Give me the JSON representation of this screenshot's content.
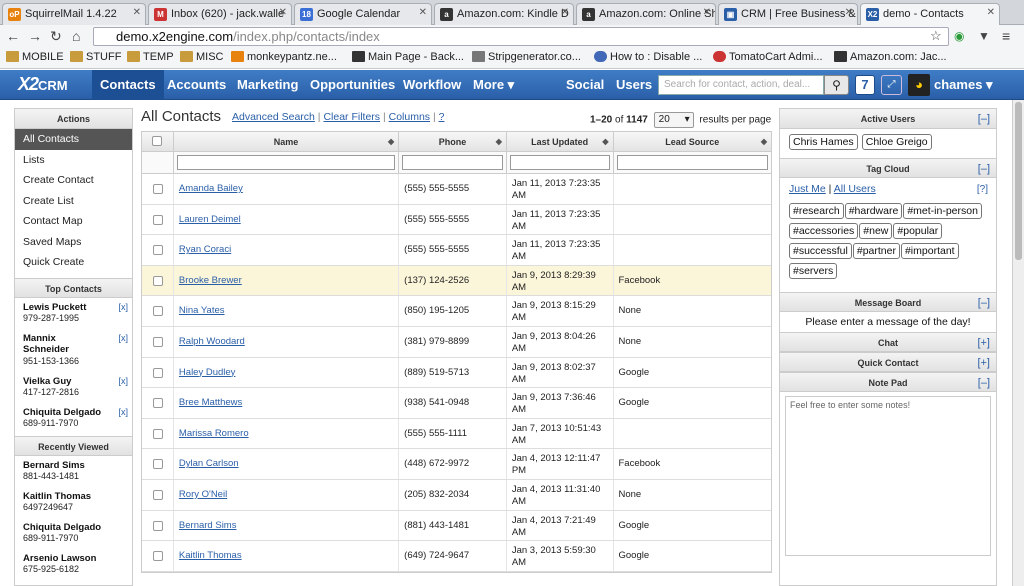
{
  "browser": {
    "tabs": [
      {
        "label": "SquirrelMail 1.4.22",
        "icon_text": "oP",
        "color": "#e8820f"
      },
      {
        "label": "Inbox (620) - jack.walle",
        "icon_text": "M",
        "color": "#c33"
      },
      {
        "label": "Google Calendar",
        "icon_text": "18",
        "color": "#3a70d6"
      },
      {
        "label": "Amazon.com: Kindle D",
        "icon_text": "a",
        "color": "#333"
      },
      {
        "label": "Amazon.com: Online Sh",
        "icon_text": "a",
        "color": "#333"
      },
      {
        "label": "CRM | Free Business &",
        "icon_text": "▣",
        "color": "#2a5fa8"
      },
      {
        "label": "demo - Contacts",
        "icon_text": "X2",
        "color": "#2a5fa8"
      }
    ],
    "window_controls": "– □ ✕",
    "url_host": "demo.x2engine.com",
    "url_path": "/index.php/contacts/index",
    "bookmarks": [
      {
        "label": "MOBILE",
        "color": "#c89b3c"
      },
      {
        "label": "STUFF",
        "color": "#c89b3c"
      },
      {
        "label": "TEMP",
        "color": "#c89b3c"
      },
      {
        "label": "MISC",
        "color": "#c89b3c"
      },
      {
        "label": "monkeypantz.ne...",
        "color": "#e8820f"
      },
      {
        "label": "Main Page - Back...",
        "color": "#333"
      },
      {
        "label": "Stripgenerator.co...",
        "color": "#777"
      },
      {
        "label": "How to : Disable ...",
        "color": "#4169b8"
      },
      {
        "label": "TomatoCart Admi...",
        "color": "#c33"
      },
      {
        "label": "Amazon.com: Jac...",
        "color": "#333"
      }
    ]
  },
  "app": {
    "logo": "X2",
    "logo_suffix": "CRM",
    "nav": [
      "Contacts",
      "Accounts",
      "Marketing",
      "Opportunities",
      "Workflow",
      "More ▾"
    ],
    "nav_right": [
      "Social",
      "Users"
    ],
    "search_placeholder": "Search for contact, action, deal...",
    "notification_count": "7",
    "username": "chames ▾",
    "accent": "#2a5fa8"
  },
  "sidebar": {
    "actions_title": "Actions",
    "actions": [
      "All Contacts",
      "Lists",
      "Create Contact",
      "Create List",
      "Contact Map",
      "Saved Maps",
      "Quick Create"
    ],
    "top_title": "Top Contacts",
    "top_contacts": [
      {
        "name": "Lewis Puckett",
        "phone": "979-287-1995"
      },
      {
        "name": "Mannix Schneider",
        "phone": "951-153-1366"
      },
      {
        "name": "Vielka Guy",
        "phone": "417-127-2816"
      },
      {
        "name": "Chiquita Delgado",
        "phone": "689-911-7970"
      }
    ],
    "remove_label": "[x]",
    "recent_title": "Recently Viewed",
    "recent": [
      {
        "name": "Bernard Sims",
        "phone": "881-443-1481"
      },
      {
        "name": "Kaitlin Thomas",
        "phone": "6497249647"
      },
      {
        "name": "Chiquita Delgado",
        "phone": "689-911-7970"
      },
      {
        "name": "Arsenio Lawson",
        "phone": "675-925-6182"
      }
    ]
  },
  "main": {
    "title": "All Contacts",
    "links": [
      "Advanced Search",
      "Clear Filters",
      "Columns",
      "?"
    ],
    "range": "1–20",
    "of_label": "of",
    "total": "1147",
    "per_page": "20",
    "per_page_label": "results per page",
    "columns": [
      "Name",
      "Phone",
      "Last Updated",
      "Lead Source"
    ],
    "rows": [
      {
        "name": "Amanda Bailey",
        "phone": "(555) 555-5555",
        "updated": "Jan 11, 2013 7:23:35 AM",
        "source": ""
      },
      {
        "name": "Lauren Deimel",
        "phone": "(555) 555-5555",
        "updated": "Jan 11, 2013 7:23:35 AM",
        "source": ""
      },
      {
        "name": "Ryan Coraci",
        "phone": "(555) 555-5555",
        "updated": "Jan 11, 2013 7:23:35 AM",
        "source": ""
      },
      {
        "name": "Brooke Brewer",
        "phone": "(137) 124-2526",
        "updated": "Jan 9, 2013 8:29:39 AM",
        "source": "Facebook"
      },
      {
        "name": "Nina Yates",
        "phone": "(850) 195-1205",
        "updated": "Jan 9, 2013 8:15:29 AM",
        "source": "None"
      },
      {
        "name": "Ralph Woodard",
        "phone": "(381) 979-8899",
        "updated": "Jan 9, 2013 8:04:26 AM",
        "source": "None"
      },
      {
        "name": "Haley Dudley",
        "phone": "(889) 519-5713",
        "updated": "Jan 9, 2013 8:02:37 AM",
        "source": "Google"
      },
      {
        "name": "Bree Matthews",
        "phone": "(938) 541-0948",
        "updated": "Jan 9, 2013 7:36:46 AM",
        "source": "Google"
      },
      {
        "name": "Marissa Romero",
        "phone": "(555) 555-1111",
        "updated": "Jan 7, 2013 10:51:43 AM",
        "source": ""
      },
      {
        "name": "Dylan Carlson",
        "phone": "(448) 672-9972",
        "updated": "Jan 4, 2013 12:11:47 PM",
        "source": "Facebook"
      },
      {
        "name": "Rory O'Neil",
        "phone": "(205) 832-2034",
        "updated": "Jan 4, 2013 11:31:40 AM",
        "source": "None"
      },
      {
        "name": "Bernard Sims",
        "phone": "(881) 443-1481",
        "updated": "Jan 4, 2013 7:21:49 AM",
        "source": "Google"
      },
      {
        "name": "Kaitlin Thomas",
        "phone": "(649) 724-9647",
        "updated": "Jan 3, 2013 5:59:30 AM",
        "source": "Google"
      }
    ]
  },
  "right": {
    "active_users_title": "Active Users",
    "active_users": [
      "Chris Hames",
      "Chloe Greigo"
    ],
    "tag_cloud_title": "Tag Cloud",
    "tag_filters": [
      "Just Me",
      "All Users"
    ],
    "tag_help": "[?]",
    "tags": [
      "#research",
      "#hardware",
      "#met-in-person",
      "#accessories",
      "#new",
      "#popular",
      "#successful",
      "#partner",
      "#important",
      "#servers"
    ],
    "message_board_title": "Message Board",
    "message": "Please enter a message of the day!",
    "chat_title": "Chat",
    "quick_contact_title": "Quick Contact",
    "note_pad_title": "Note Pad",
    "note_placeholder": "Feel free to enter some notes!",
    "collapse": "[–]",
    "expand": "[+]"
  }
}
